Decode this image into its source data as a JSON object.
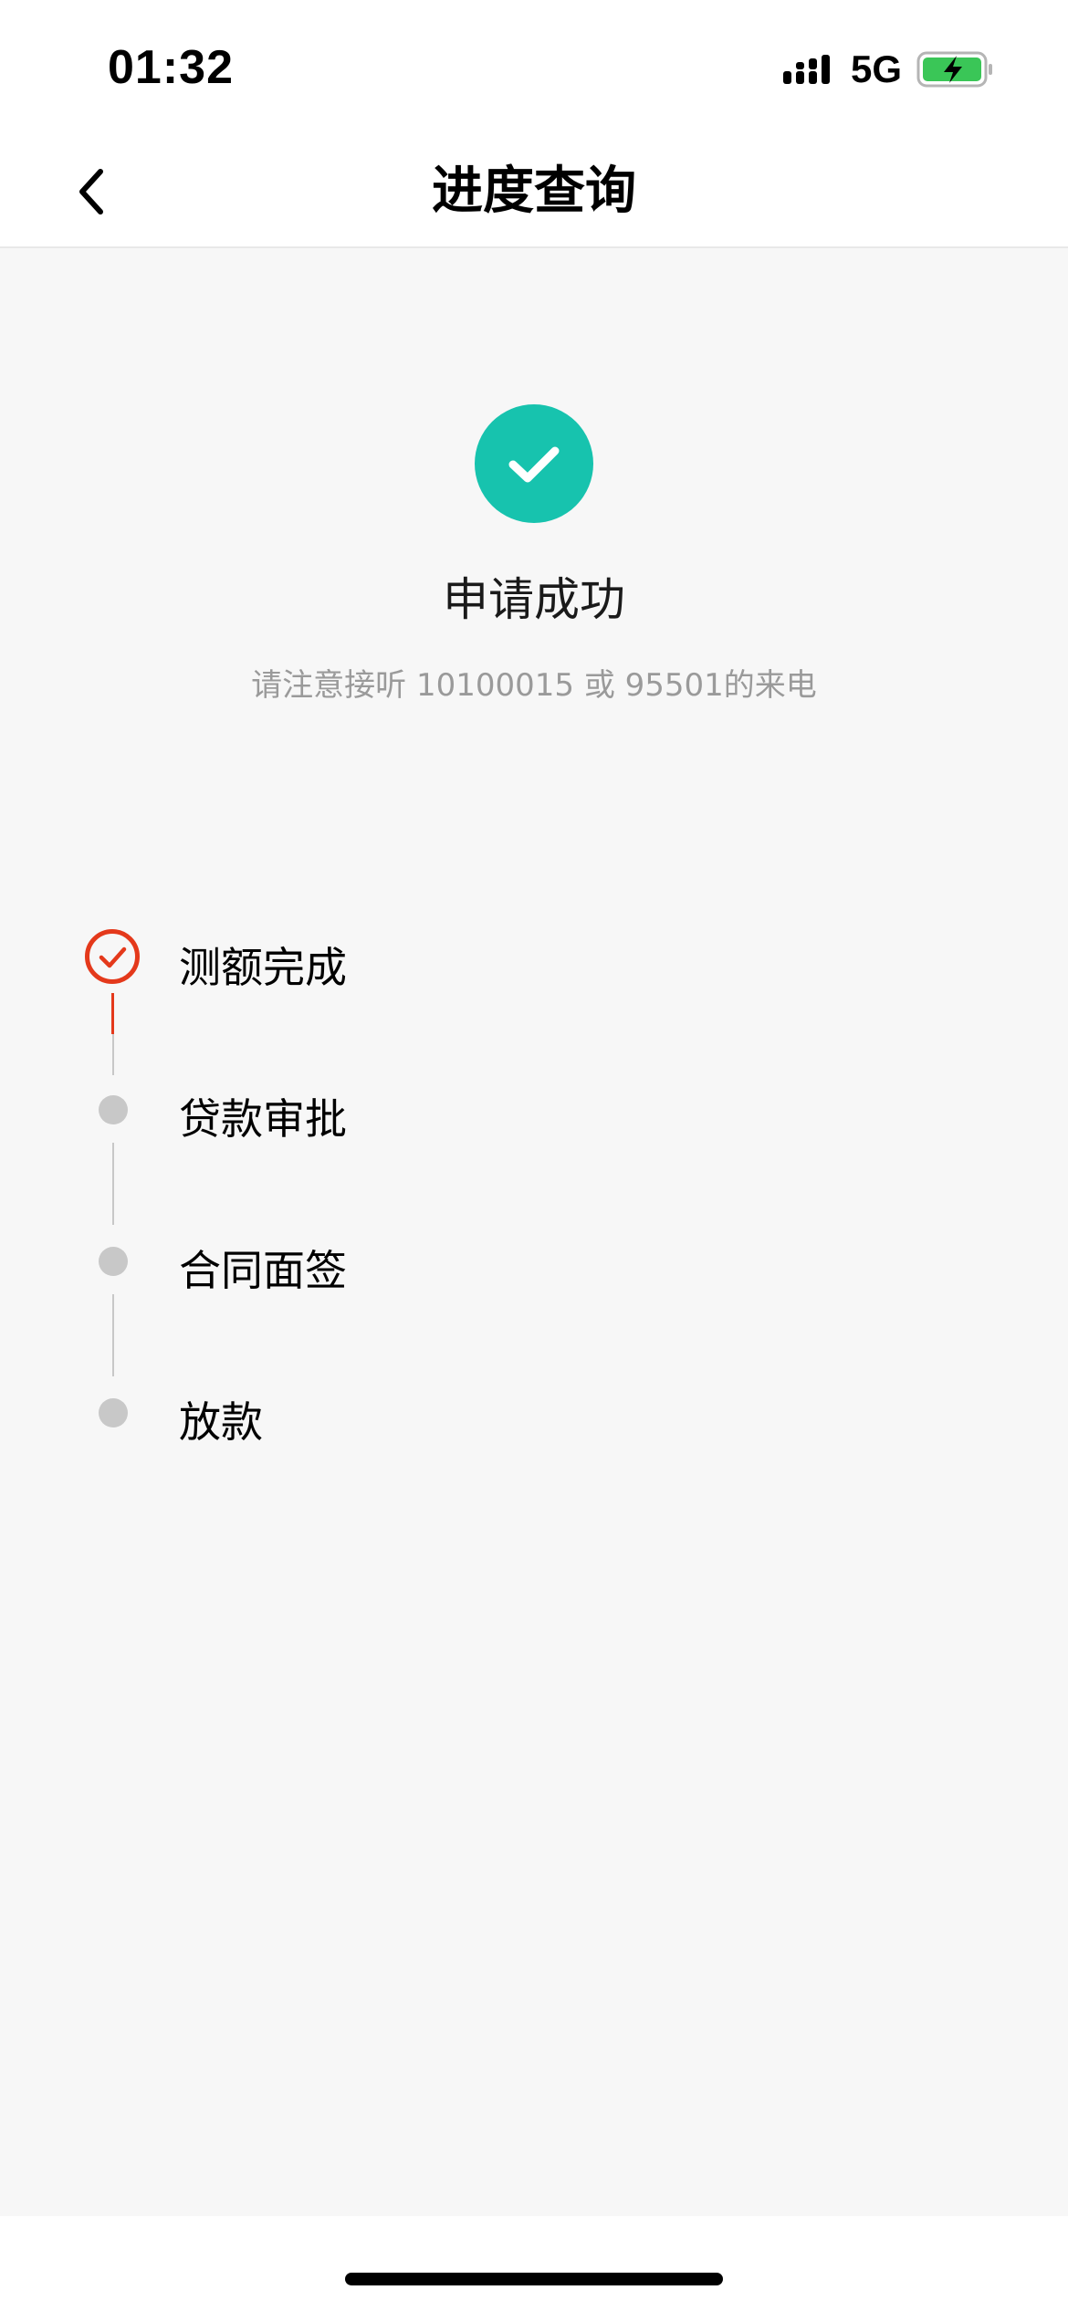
{
  "status_bar": {
    "time": "01:32",
    "network": "5G",
    "signal_icon": "signal-bars-icon",
    "battery_icon": "battery-charging-icon",
    "battery_color": "#3ac657"
  },
  "nav": {
    "title": "进度查询",
    "back_icon": "chevron-left-icon"
  },
  "result": {
    "icon": "check-circle-icon",
    "icon_color": "#17c3ae",
    "title": "申请成功",
    "subtitle": "请注意接听 10100015 或 95501的来电"
  },
  "timeline": {
    "active_color": "#e4391b",
    "inactive_color": "#c8c8c8",
    "steps": [
      {
        "label": "测额完成",
        "status": "done"
      },
      {
        "label": "贷款审批",
        "status": "pending"
      },
      {
        "label": "合同面签",
        "status": "pending"
      },
      {
        "label": "放款",
        "status": "pending"
      }
    ]
  }
}
